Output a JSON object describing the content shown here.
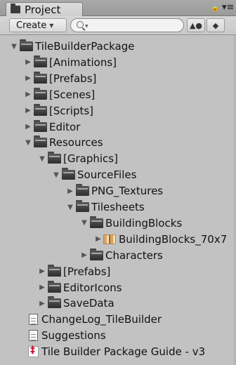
{
  "window": {
    "tab_label": "Project",
    "lock_glyph": "🔒",
    "menu_glyph": "▾≡"
  },
  "toolbar": {
    "create_label": "Create",
    "search_placeholder": "",
    "filter_type_icon": "filter-type-icon",
    "filter_label_icon": "filter-label-icon"
  },
  "tree": [
    {
      "label": "TileBuilderPackage",
      "depth": 0,
      "expanded": true,
      "type": "folder"
    },
    {
      "label": "[Animations]",
      "depth": 1,
      "expanded": false,
      "type": "folder"
    },
    {
      "label": "[Prefabs]",
      "depth": 1,
      "expanded": false,
      "type": "folder"
    },
    {
      "label": "[Scenes]",
      "depth": 1,
      "expanded": false,
      "type": "folder"
    },
    {
      "label": "[Scripts]",
      "depth": 1,
      "expanded": false,
      "type": "folder"
    },
    {
      "label": "Editor",
      "depth": 1,
      "expanded": false,
      "type": "folder"
    },
    {
      "label": "Resources",
      "depth": 1,
      "expanded": true,
      "type": "folder"
    },
    {
      "label": "[Graphics]",
      "depth": 2,
      "expanded": true,
      "type": "folder"
    },
    {
      "label": "SourceFiles",
      "depth": 3,
      "expanded": true,
      "type": "folder"
    },
    {
      "label": "PNG_Textures",
      "depth": 4,
      "expanded": false,
      "type": "folder"
    },
    {
      "label": "Tilesheets",
      "depth": 4,
      "expanded": true,
      "type": "folder"
    },
    {
      "label": "BuildingBlocks",
      "depth": 5,
      "expanded": true,
      "type": "folder"
    },
    {
      "label": "BuildingBlocks_70x7",
      "depth": 6,
      "expanded": false,
      "type": "texture"
    },
    {
      "label": "Characters",
      "depth": 5,
      "expanded": false,
      "type": "folder"
    },
    {
      "label": "[Prefabs]",
      "depth": 2,
      "expanded": false,
      "type": "folder"
    },
    {
      "label": "EditorIcons",
      "depth": 2,
      "expanded": false,
      "type": "folder"
    },
    {
      "label": "SaveData",
      "depth": 2,
      "expanded": false,
      "type": "folder"
    },
    {
      "label": "ChangeLog_TileBuilder",
      "depth": 1,
      "type": "doc"
    },
    {
      "label": "Suggestions",
      "depth": 1,
      "type": "doc"
    },
    {
      "label": "Tile Builder Package Guide - v3",
      "depth": 1,
      "type": "pdf"
    }
  ]
}
